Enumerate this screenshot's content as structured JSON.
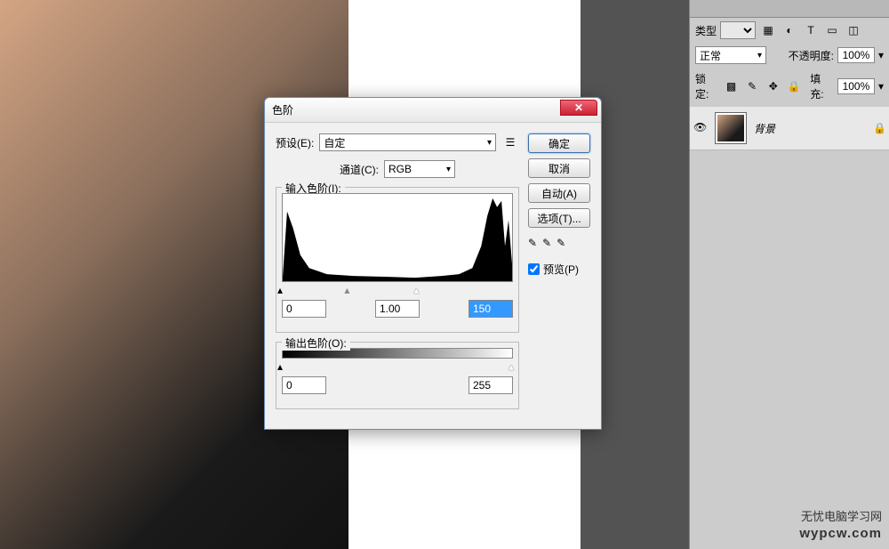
{
  "dialog": {
    "title": "色阶",
    "preset_label": "预设(E):",
    "preset_value": "自定",
    "channel_label": "通道(C):",
    "channel_value": "RGB",
    "input_levels_label": "输入色阶(I):",
    "output_levels_label": "输出色阶(O):",
    "input_black": "0",
    "input_gamma": "1.00",
    "input_white": "150",
    "output_black": "0",
    "output_white": "255",
    "ok_button": "确定",
    "cancel_button": "取消",
    "auto_button": "自动(A)",
    "options_button": "选项(T)...",
    "preview_label": "预览(P)",
    "preview_checked": true
  },
  "layers_panel": {
    "type_label": "类型",
    "blend_mode": "正常",
    "opacity_label": "不透明度:",
    "opacity_value": "100%",
    "lock_label": "锁定:",
    "fill_label": "填充:",
    "fill_value": "100%",
    "layer_name": "背景"
  },
  "watermark": {
    "cn": "无忧电脑学习网",
    "url": "wypcw.com"
  }
}
